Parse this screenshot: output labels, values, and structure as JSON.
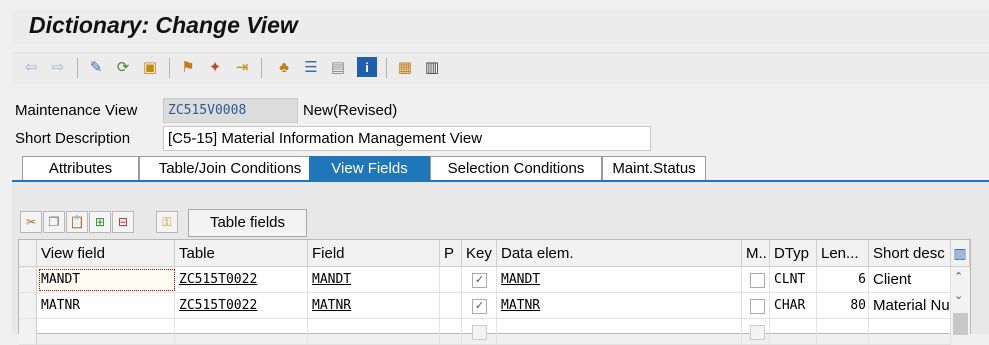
{
  "window_title": "Dictionary: Change View",
  "toolbar": {
    "icons": [
      "back-arrow-icon",
      "forward-arrow-icon",
      "display-change-icon",
      "other-object-icon",
      "activate-icon",
      "check-icon",
      "where-used-icon",
      "navigation-icon",
      "object-list-icon",
      "hierarchy-icon",
      "table-icon",
      "info-icon",
      "technical-settings-icon",
      "layout-icon"
    ]
  },
  "header": {
    "maintenance_view_label": "Maintenance View",
    "maintenance_view_value": "ZC515V0008",
    "status": "New(Revised)",
    "short_description_label": "Short Description",
    "short_description_value": "[C5-15] Material Information Management View"
  },
  "tabs": [
    "Attributes",
    "Table/Join Conditions",
    "View Fields",
    "Selection Conditions",
    "Maint.Status"
  ],
  "active_tab": "View Fields",
  "table_fields_button": "Table fields",
  "grid": {
    "columns": [
      "View field",
      "Table",
      "Field",
      "P",
      "Key",
      "Data elem.",
      "M..",
      "DTyp",
      "Len...",
      "Short desc"
    ],
    "rows": [
      {
        "view_field": "MANDT",
        "table": "ZC515T0022",
        "field": "MANDT",
        "p": "",
        "key": true,
        "data_elem": "MANDT",
        "m": false,
        "dtyp": "CLNT",
        "len": "6",
        "short_desc": "Client"
      },
      {
        "view_field": "MATNR",
        "table": "ZC515T0022",
        "field": "MATNR",
        "p": "",
        "key": true,
        "data_elem": "MATNR",
        "m": false,
        "dtyp": "CHAR",
        "len": "80",
        "short_desc": "Material Nu"
      }
    ]
  },
  "colors": {
    "accent": "#1f76b9",
    "title_bg": "#ececec",
    "panel_bg": "#e8e8e8"
  }
}
